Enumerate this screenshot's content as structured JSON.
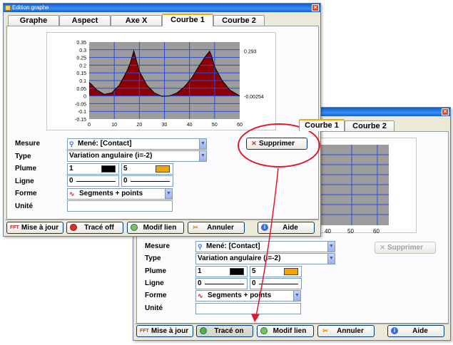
{
  "front": {
    "title": "Edition graphe",
    "tabs": [
      "Graphe",
      "Aspect",
      "Axe X",
      "Courbe 1",
      "Courbe 2"
    ],
    "active_tab": "Courbe 1",
    "labels": {
      "mesure": "Mesure",
      "type": "Type",
      "plume": "Plume",
      "ligne": "Ligne",
      "forme": "Forme",
      "unite": "Unité"
    },
    "fields": {
      "mesure": "Mené: [Contact]",
      "type": "Variation angulaire (i=-2)",
      "plume_width": "1",
      "plume_color_index": "5",
      "ligne_a": "0",
      "ligne_b": "0",
      "forme": "Segments + points",
      "unite": ""
    },
    "buttons": {
      "supprimer": "Supprimer",
      "mise_a_jour": "Mise à jour",
      "trace": "Tracé off",
      "modif_lien": "Modif lien",
      "annuler": "Annuler",
      "aide": "Aide"
    },
    "chart_labels": {
      "right_top": "0.293",
      "right_bottom": "-0.00254"
    }
  },
  "back": {
    "tabs": [
      "Courbe 1",
      "Courbe 2"
    ],
    "labels": {
      "mesure": "Mesure",
      "type": "Type",
      "plume": "Plume",
      "ligne": "Ligne",
      "forme": "Forme",
      "unite": "Unité"
    },
    "fields": {
      "mesure": "Mené: [Contact]",
      "type": "Variation angulaire (i=-2)",
      "plume_width": "1",
      "plume_color_index": "5",
      "ligne_a": "0",
      "ligne_b": "0",
      "forme": "Segments + points",
      "unite": ""
    },
    "buttons": {
      "supprimer": "Supprimer",
      "mise_a_jour": "Mise à jour",
      "trace": "Tracé on",
      "modif_lien": "Modif lien",
      "annuler": "Annuler",
      "aide": "Aide"
    },
    "chart_ticks": [
      "40",
      "50",
      "60"
    ]
  },
  "colors": {
    "fill": "#8b0000",
    "plot_bg": "#9c9c9c",
    "grid": "#2a4de0",
    "plume_front": "#000000",
    "plume_color": "#f5a300",
    "annotation": "#e0192a"
  },
  "chart_data": {
    "type": "area",
    "xlim": [
      0,
      60
    ],
    "ylim": [
      -0.15,
      0.35
    ],
    "xticks": [
      0,
      10,
      20,
      30,
      40,
      50,
      60
    ],
    "yticks": [
      -0.15,
      -0.1,
      -0.05,
      0,
      0.05,
      0.1,
      0.15,
      0.2,
      0.25,
      0.3,
      0.35
    ],
    "x": [
      0,
      3,
      6,
      9,
      12,
      15,
      16.5,
      17.8,
      18.5,
      20,
      23,
      26,
      29,
      32,
      35,
      38,
      41,
      44,
      46.5,
      48,
      48.8,
      50,
      53,
      56,
      59,
      60
    ],
    "y": [
      0.09,
      0.04,
      0.01,
      0.02,
      0.07,
      0.16,
      0.22,
      0.293,
      0.25,
      0.16,
      0.07,
      0.02,
      -0.0025,
      0.0,
      0.02,
      0.06,
      0.12,
      0.2,
      0.26,
      0.29,
      0.26,
      0.19,
      0.1,
      0.04,
      0.01,
      0.0
    ]
  }
}
